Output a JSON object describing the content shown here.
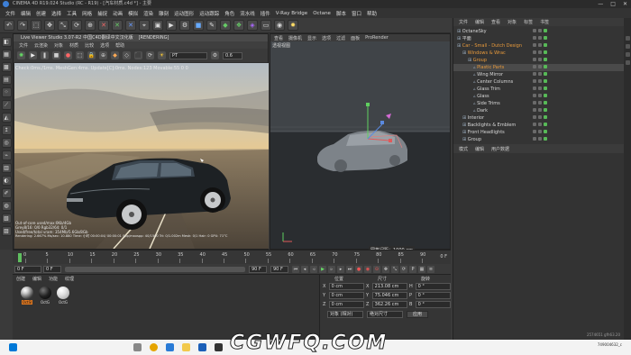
{
  "window": {
    "title": "CINEMA 4D R19.024 Studio (RC - R19) - [汽车材质.c4d *] - 主要",
    "controls": [
      "—",
      "□",
      "✕"
    ]
  },
  "menubar": [
    "文件",
    "编辑",
    "创建",
    "选择",
    "工具",
    "网格",
    "捕捉",
    "动画",
    "模拟",
    "渲染",
    "雕刻",
    "运动图形",
    "运动跟踪",
    "角色",
    "流水线",
    "插件",
    "V-Ray Bridge",
    "Octane",
    "脚本",
    "窗口",
    "帮助"
  ],
  "live_viewer": {
    "title": "Live Viewer Studio 3.07-R2 中国C4D翻译中文汉化版",
    "rendering_tag": "[RENDERING]",
    "menu": [
      "文件",
      "云渲染",
      "对象",
      "材质",
      "比较",
      "选项",
      "帮助"
    ],
    "kernel_select": "PT",
    "value_field": "0.6",
    "status": "Check:0ms./1ms. MeshGen:4ms. Update[C]:0ms. Nodes:123 Movable:55 0 0",
    "bottom_lines": [
      "Out-of-core used/max:0Kb/4Gb",
      "Grey8/16: 0/0          Rgb32/64: 0/1",
      "Used/free/total vram: 354Mb/5.6Gb/8Gb",
      "Rendering: 2.667%  Ms/sec: 10.880  Time: 小时 00:00:04/ 00:00:01  Spp/maxspp: 40/1500  Tri: 0/1.002m  Mesh: 0/1  Hair: 0  GPU: 71°C"
    ]
  },
  "viewport": {
    "menu": [
      "查看",
      "摄像机",
      "显示",
      "选项",
      "过滤",
      "面板",
      "ProRender"
    ],
    "label": "透视视图",
    "grid_spacing": "网格间距：1000 cm"
  },
  "object_manager": {
    "tabs": [
      "文件",
      "编辑",
      "查看",
      "对象",
      "标签",
      "书签"
    ],
    "items": [
      {
        "label": "OctaneSky",
        "indent": 0,
        "color": "#d8d8d8"
      },
      {
        "label": "平面",
        "indent": 0,
        "color": "#d8d8d8"
      },
      {
        "label": "Car - Small - Dutch Design",
        "indent": 0,
        "color": "#e89a3c"
      },
      {
        "label": "Windows & Wrac",
        "indent": 1,
        "color": "#e89a3c"
      },
      {
        "label": "Group",
        "indent": 2,
        "color": "#e89a3c"
      },
      {
        "label": "Plastic Parts",
        "indent": 3,
        "color": "#e89a3c"
      },
      {
        "label": "Wing Mirror",
        "indent": 3,
        "color": "#d8d8d8"
      },
      {
        "label": "Center Columns",
        "indent": 3,
        "color": "#d8d8d8"
      },
      {
        "label": "Glass Trim",
        "indent": 3,
        "color": "#d8d8d8"
      },
      {
        "label": "Glass",
        "indent": 3,
        "color": "#d8d8d8"
      },
      {
        "label": "Side Trims",
        "indent": 3,
        "color": "#d8d8d8"
      },
      {
        "label": "Dark",
        "indent": 3,
        "color": "#d8d8d8"
      },
      {
        "label": "Interior",
        "indent": 1,
        "color": "#d8d8d8"
      },
      {
        "label": "Backlights & Emblem",
        "indent": 1,
        "color": "#d8d8d8"
      },
      {
        "label": "Front Headlights",
        "indent": 1,
        "color": "#d8d8d8"
      },
      {
        "label": "Group",
        "indent": 1,
        "color": "#d8d8d8"
      }
    ]
  },
  "attributes": {
    "tabs": [
      "模式",
      "编辑",
      "用户数据"
    ],
    "footer": "2574651 gfh63.20"
  },
  "timeline": {
    "ticks": [
      "0",
      "5",
      "10",
      "15",
      "20",
      "25",
      "30",
      "35",
      "40",
      "45",
      "50",
      "55",
      "60",
      "65",
      "70",
      "75",
      "80",
      "85",
      "90"
    ],
    "current_frame": "0 F",
    "start_field": "0 F",
    "end_field": "90 F",
    "end_field2": "90 F",
    "end_label": "0 F"
  },
  "materials": {
    "tabs": [
      "创建",
      "编辑",
      "功能",
      "纹理"
    ],
    "items": [
      {
        "label": "OctSl",
        "color": "#e07820"
      },
      {
        "label": "OctG",
        "color": "#1b1b1b"
      },
      {
        "label": "OctG",
        "color": "#d8d8d8"
      }
    ]
  },
  "coordinates": {
    "headers": [
      "位置",
      "尺寸",
      "旋转"
    ],
    "rows": [
      {
        "axis": "X",
        "pos": "0 cm",
        "size_axis": "X",
        "size": "213.08 cm",
        "rot_axis": "H",
        "rot": "0 °"
      },
      {
        "axis": "Y",
        "pos": "0 cm",
        "size_axis": "Y",
        "size": "75.046 cm",
        "rot_axis": "P",
        "rot": "0 °"
      },
      {
        "axis": "Z",
        "pos": "0 cm",
        "size_axis": "Z",
        "size": "362.26 cm",
        "rot_axis": "B",
        "rot": "0 °"
      }
    ],
    "mode_select": "对象 (相对)",
    "size_select": "绝对尺寸",
    "apply_button": "应用"
  },
  "taskbar": {
    "right_text": "749004632_c"
  },
  "watermark": "CGWFQ.COM"
}
